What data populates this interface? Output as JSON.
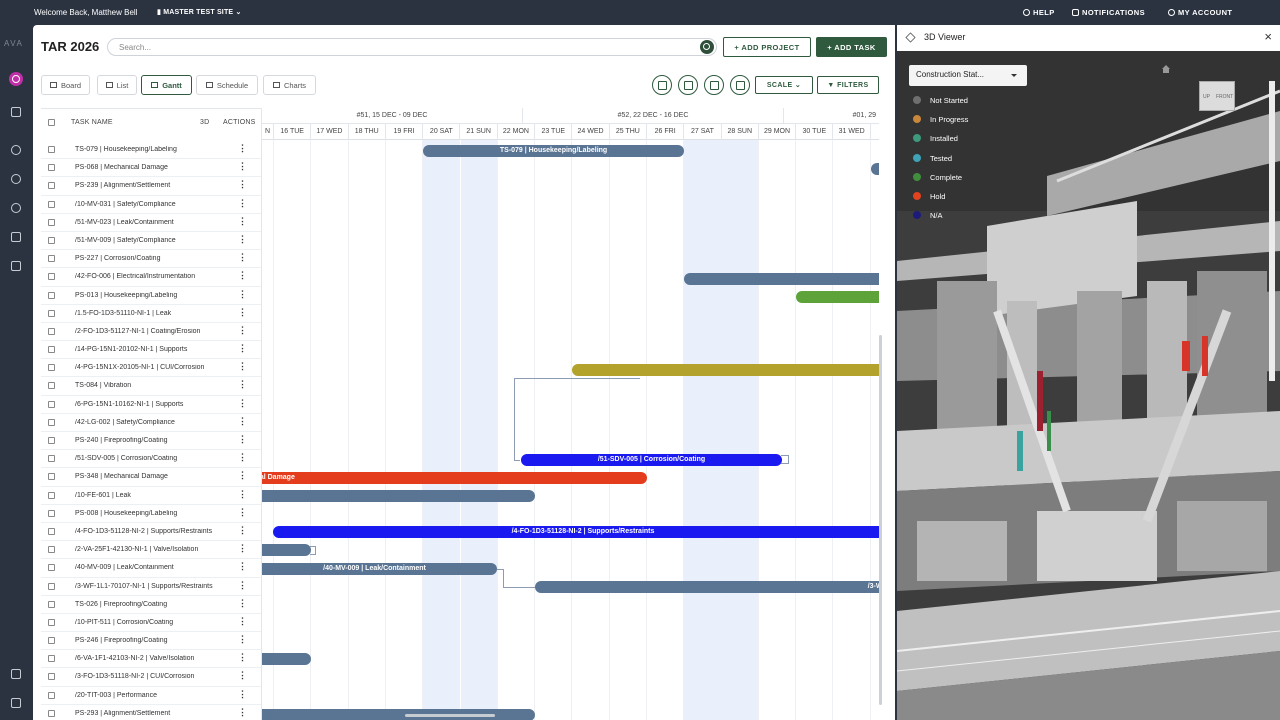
{
  "topbar": {
    "welcome": "Welcome Back, Matthew Bell",
    "site": "MASTER TEST SITE",
    "help": "HELP",
    "notifications": "NOTIFICATIONS",
    "account": "MY ACCOUNT"
  },
  "rail": {
    "logo": "AVA"
  },
  "header": {
    "title": "TAR 2026",
    "search_placeholder": "Search...",
    "add_project": "+ ADD PROJECT",
    "add_task": "+ ADD TASK"
  },
  "views": {
    "board": "Board",
    "list": "List",
    "gantt": "Gantt",
    "schedule": "Schedule",
    "charts": "Charts",
    "scale": "SCALE",
    "filters": "FILTERS"
  },
  "grid": {
    "columns": {
      "task_name": "TASK NAME",
      "three_d": "3D",
      "actions": "ACTIONS"
    },
    "rows": [
      "TS-079 | Housekeeping/Labeling",
      "PS-068 | Mechanical Damage",
      "PS-239 | Alignment/Settlement",
      "/10-MV-031 | Safety/Compliance",
      "/51-MV-023 | Leak/Containment",
      "/51-MV-009 | Safety/Compliance",
      "PS-227 | Corrosion/Coating",
      "/42-FO-006 | Electrical/Instrumentation",
      "PS-013 | Housekeeping/Labeling",
      "/1.5-FO-1D3-51110-NI-1 | Leak",
      "/2-FO-1D3-51127-NI-1 | Coating/Erosion",
      "/14-PG-15N1-20102-NI-1 | Supports",
      "/4-PG-15N1X-20105-NI-1 | CUI/Corrosion",
      "TS-084 | Vibration",
      "/6-PG-15N1-10162-NI-1 | Supports",
      "/42-LG-002 | Safety/Compliance",
      "PS-240 | Fireproofing/Coating",
      "/51-SDV-005 | Corrosion/Coating",
      "PS-348 | Mechanical Damage",
      "/10-FE-601 | Leak",
      "PS-008 | Housekeeping/Labeling",
      "/4-FO-1D3-51128-NI-2 | Supports/Restraints",
      "/2-VA-25F1-42130-NI-1 | Valve/Isolation",
      "/40-MV-009 | Leak/Containment",
      "/3-WF-1L1-70107-NI-1 | Supports/Restraints",
      "TS-026 | Fireproofing/Coating",
      "/10-PIT-511 | Corrosion/Coating",
      "PS-246 | Fireproofing/Coating",
      "/6-VA-1F1-42103-NI-2 | Valve/Isolation",
      "/3-FO-1D3-51118-NI-2 | CUI/Corrosion",
      "/20-TIT-003 | Performance",
      "PS-293 | Alignment/Settlement"
    ]
  },
  "gantt": {
    "weeks": [
      "#51, 15 DEC - 09 DEC",
      "#52, 22 DEC - 16 DEC",
      "#01, 29"
    ],
    "days": [
      "N",
      "16 TUE",
      "17 WED",
      "18 THU",
      "19 FRI",
      "20 SAT",
      "21 SUN",
      "22 MON",
      "23 TUE",
      "24 WED",
      "25 THU",
      "26 FRI",
      "27 SAT",
      "28 SUN",
      "29 MON",
      "30 TUE",
      "31 WED"
    ],
    "bar_labels": {
      "ts079": "TS-079 | Housekeeping/Labeling",
      "ps013": "PS",
      "sdv005": "/51-SDV-005 | Corrosion/Coating",
      "ps348": "ical Damage",
      "fo51128": "/4-FO-1D3-51128-NI-2 | Supports/Restraints",
      "mv009": "/40-MV-009 | Leak/Containment",
      "wf70107": "/3-WF-1"
    }
  },
  "viewer": {
    "title": "3D Viewer",
    "dropdown": "Construction Stat...",
    "cube_up": "UP",
    "cube_front": "FRONT",
    "legend": [
      {
        "label": "Not Started",
        "color": "#6f6f6f"
      },
      {
        "label": "In Progress",
        "color": "#c8873a"
      },
      {
        "label": "Installed",
        "color": "#3d9a7c"
      },
      {
        "label": "Tested",
        "color": "#3ea3b7"
      },
      {
        "label": "Complete",
        "color": "#3f8f3d"
      },
      {
        "label": "Hold",
        "color": "#e2421e"
      },
      {
        "label": "N/A",
        "color": "#1d1b7a"
      }
    ]
  },
  "colors": {
    "brand": "#2f5a3e",
    "bar_slate": "#5a7594",
    "bar_blue": "#1919f0",
    "bar_red": "#e43d1e",
    "bar_olive": "#b3a22b",
    "bar_green": "#5da33a"
  }
}
